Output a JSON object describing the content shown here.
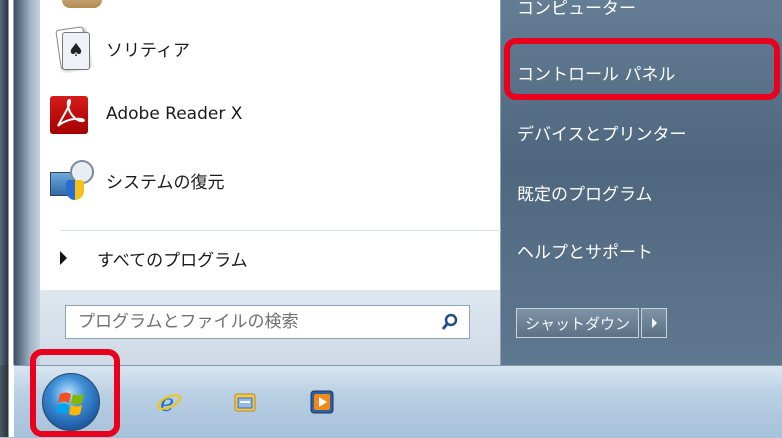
{
  "start_menu": {
    "programs": [
      {
        "label": "ソリティア",
        "icon": "solitaire-icon"
      },
      {
        "label": "Adobe Reader X",
        "icon": "adobe-reader-icon"
      },
      {
        "label": "システムの復元",
        "icon": "system-restore-icon"
      }
    ],
    "all_programs_label": "すべてのプログラム",
    "search_placeholder": "プログラムとファイルの検索",
    "right_items": [
      {
        "label": "コンピューター"
      },
      {
        "label": "コントロール パネル"
      },
      {
        "label": "デバイスとプリンター"
      },
      {
        "label": "既定のプログラム"
      },
      {
        "label": "ヘルプとサポート"
      }
    ],
    "shutdown_label": "シャットダウン"
  },
  "taskbar": {
    "items": [
      "start-orb",
      "internet-explorer-icon",
      "file-explorer-icon",
      "media-player-icon"
    ]
  },
  "colors": {
    "highlight": "#e8001c",
    "right_pane": "#566f87",
    "taskbar": "#b9cfe3"
  }
}
